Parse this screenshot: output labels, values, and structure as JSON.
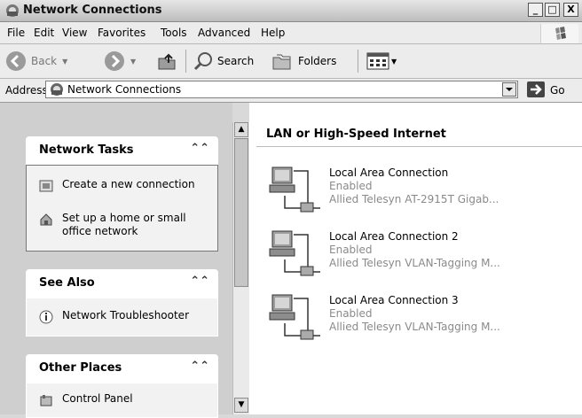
{
  "window": {
    "title": "Network Connections",
    "minimize_glyph": "_",
    "maximize_glyph": "□",
    "close_glyph": "X"
  },
  "menu": [
    "File",
    "Edit",
    "View",
    "Favorites",
    "Tools",
    "Advanced",
    "Help"
  ],
  "toolbar": {
    "back_label": "Back",
    "search_label": "Search",
    "folders_label": "Folders"
  },
  "address": {
    "label": "Address",
    "value": "Network Connections",
    "go_label": "Go"
  },
  "panels": {
    "network_tasks": {
      "title": "Network Tasks",
      "items": [
        "Create a new connection",
        "Set up a home or small office network"
      ]
    },
    "see_also": {
      "title": "See Also",
      "items": [
        "Network Troubleshooter"
      ]
    },
    "other_places": {
      "title": "Other Places",
      "items": [
        "Control Panel"
      ]
    }
  },
  "content": {
    "group_title": "LAN or High-Speed Internet",
    "connections": [
      {
        "name": "Local Area Connection",
        "status": "Enabled",
        "device": "Allied Telesyn AT-2915T Gigab..."
      },
      {
        "name": "Local Area Connection 2",
        "status": "Enabled",
        "device": "Allied Telesyn VLAN-Tagging M..."
      },
      {
        "name": "Local Area Connection 3",
        "status": "Enabled",
        "device": "Allied Telesyn VLAN-Tagging M..."
      }
    ]
  }
}
